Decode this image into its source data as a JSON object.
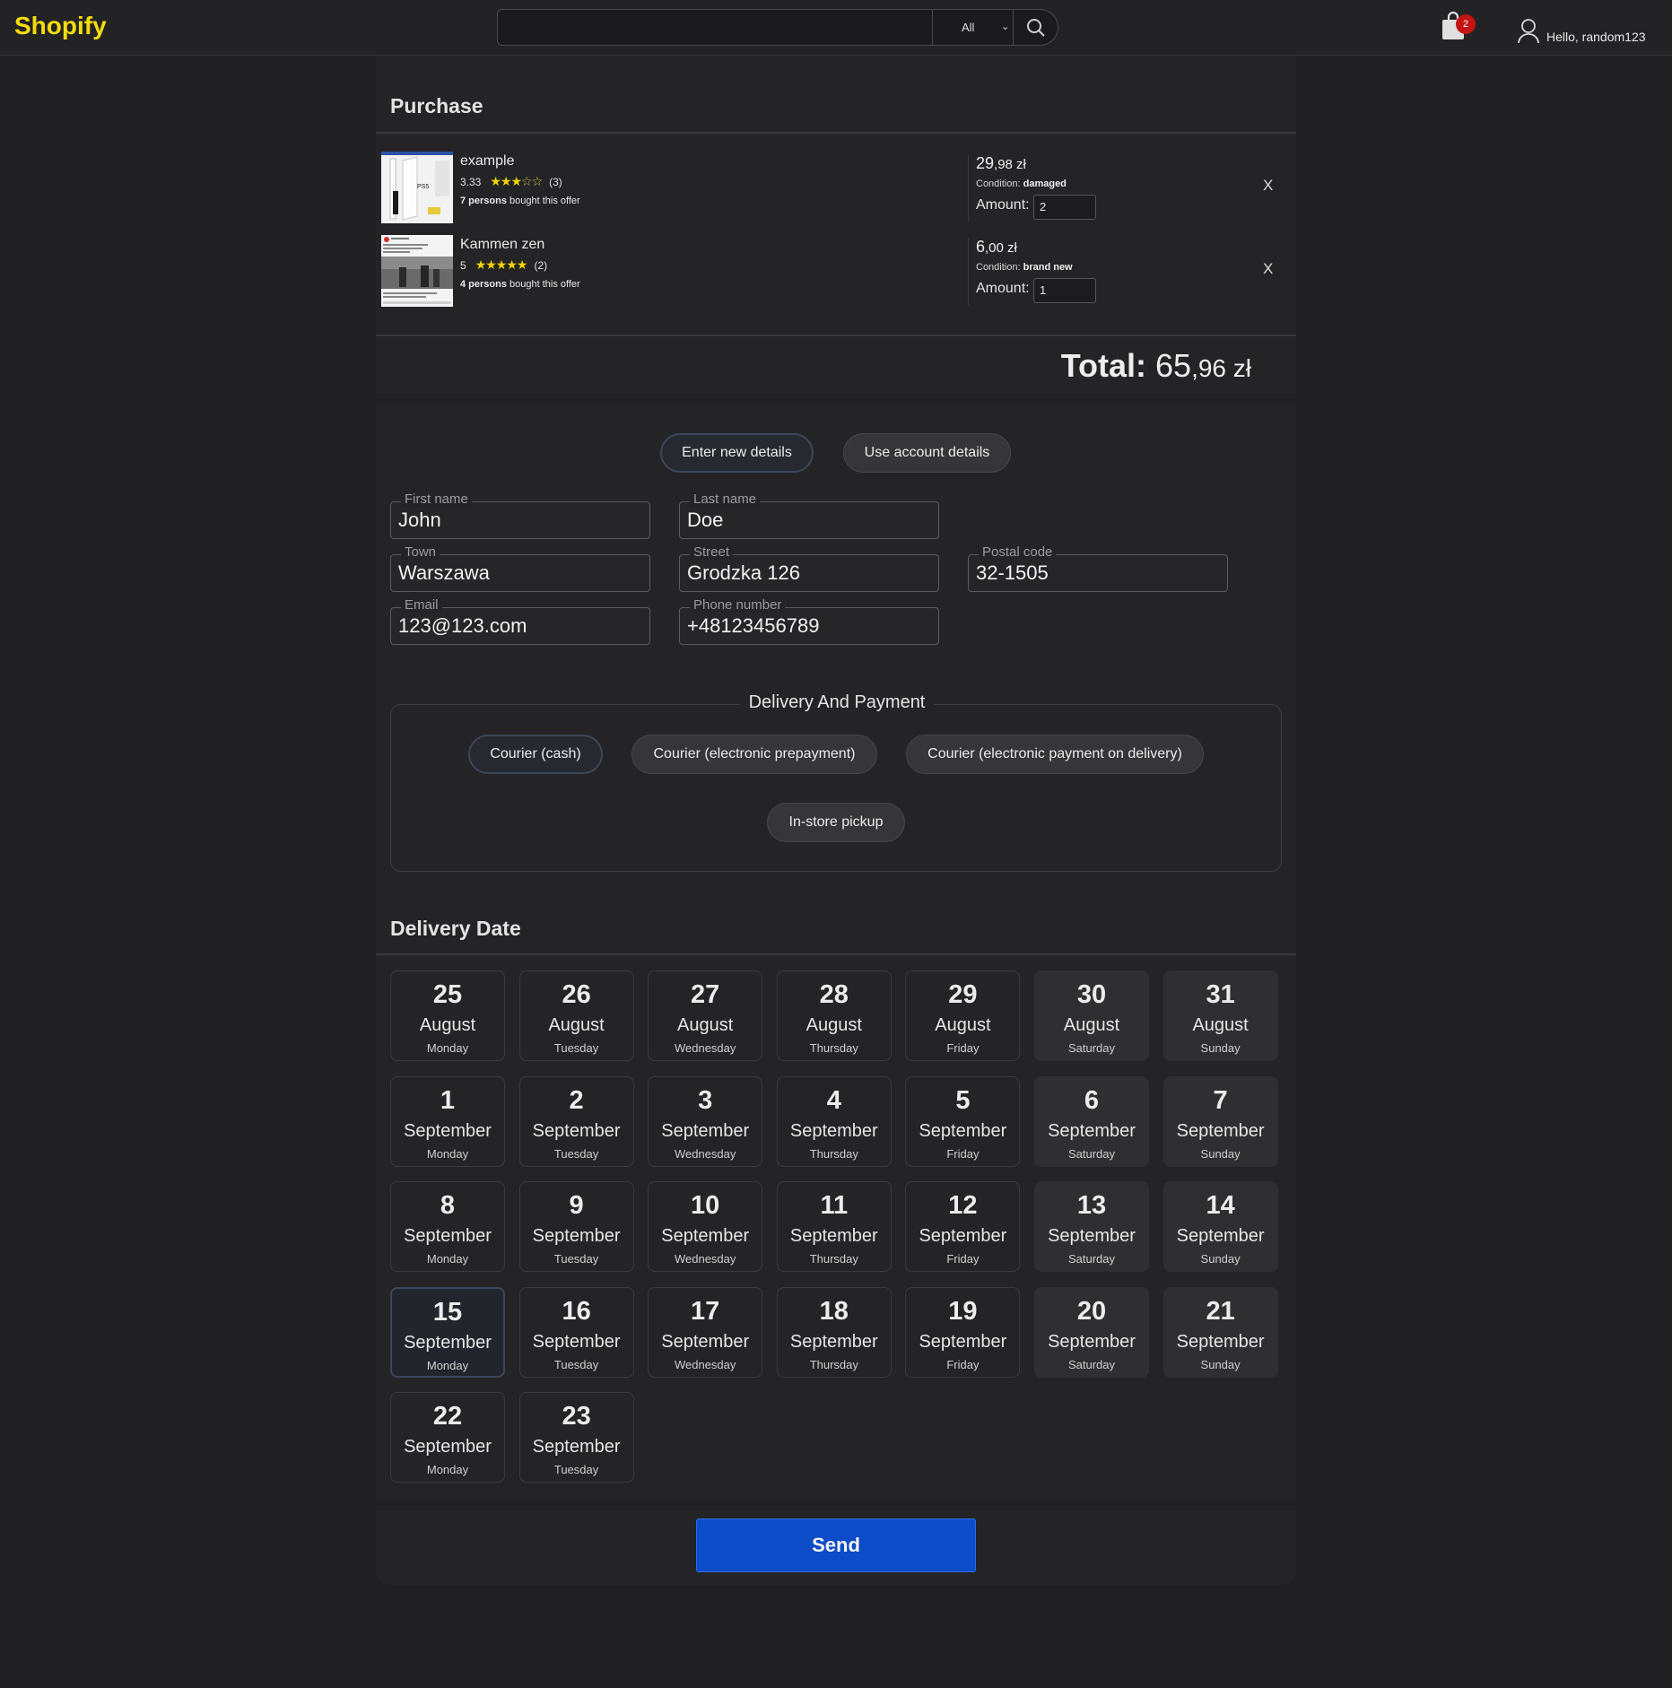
{
  "header": {
    "logo": "Shopify",
    "search_placeholder": "",
    "category": "All",
    "cart_count": "2",
    "user_greeting": "Hello, random123"
  },
  "purchase": {
    "title": "Purchase",
    "items": [
      {
        "name": "example",
        "rating": "3.33",
        "stars_filled": 3,
        "stars_total": 5,
        "reviews": "(3)",
        "bought_count": "7 persons",
        "bought_text": "bought this offer",
        "price_main": "29",
        "price_dec": ",98 zł",
        "condition_label": "Condition:",
        "condition": "damaged",
        "amount_label": "Amount:",
        "amount": "2",
        "remove": "X"
      },
      {
        "name": "Kammen zen",
        "rating": "5",
        "stars_filled": 5,
        "stars_total": 5,
        "reviews": "(2)",
        "bought_count": "4 persons",
        "bought_text": "bought this offer",
        "price_main": "6",
        "price_dec": ",00 zł",
        "condition_label": "Condition:",
        "condition": "brand new",
        "amount_label": "Amount:",
        "amount": "1",
        "remove": "X"
      }
    ],
    "total_label": "Total:",
    "total_main": "65",
    "total_dec": ",96 zł"
  },
  "details": {
    "enter_new": "Enter new details",
    "use_account": "Use account details",
    "fields": {
      "first_name": {
        "label": "First name",
        "value": "John"
      },
      "last_name": {
        "label": "Last name",
        "value": "Doe"
      },
      "town": {
        "label": "Town",
        "value": "Warszawa"
      },
      "street": {
        "label": "Street",
        "value": "Grodzka 126"
      },
      "postal": {
        "label": "Postal code",
        "value": "32-1505"
      },
      "email": {
        "label": "Email",
        "value": "123@123.com"
      },
      "phone": {
        "label": "Phone number",
        "value": "+48123456789"
      }
    }
  },
  "delivery_payment": {
    "title": "Delivery And Payment",
    "options": [
      "Courier (cash)",
      "Courier (electronic prepayment)",
      "Courier (electronic payment on delivery)",
      "In-store pickup"
    ],
    "selected": "Courier (cash)"
  },
  "delivery_date": {
    "title": "Delivery Date",
    "selected_index": 21,
    "days": [
      {
        "num": "25",
        "month": "August",
        "weekday": "Monday"
      },
      {
        "num": "26",
        "month": "August",
        "weekday": "Tuesday"
      },
      {
        "num": "27",
        "month": "August",
        "weekday": "Wednesday"
      },
      {
        "num": "28",
        "month": "August",
        "weekday": "Thursday"
      },
      {
        "num": "29",
        "month": "August",
        "weekday": "Friday"
      },
      {
        "num": "30",
        "month": "August",
        "weekday": "Saturday"
      },
      {
        "num": "31",
        "month": "August",
        "weekday": "Sunday"
      },
      {
        "num": "1",
        "month": "September",
        "weekday": "Monday"
      },
      {
        "num": "2",
        "month": "September",
        "weekday": "Tuesday"
      },
      {
        "num": "3",
        "month": "September",
        "weekday": "Wednesday"
      },
      {
        "num": "4",
        "month": "September",
        "weekday": "Thursday"
      },
      {
        "num": "5",
        "month": "September",
        "weekday": "Friday"
      },
      {
        "num": "6",
        "month": "September",
        "weekday": "Saturday"
      },
      {
        "num": "7",
        "month": "September",
        "weekday": "Sunday"
      },
      {
        "num": "8",
        "month": "September",
        "weekday": "Monday"
      },
      {
        "num": "9",
        "month": "September",
        "weekday": "Tuesday"
      },
      {
        "num": "10",
        "month": "September",
        "weekday": "Wednesday"
      },
      {
        "num": "11",
        "month": "September",
        "weekday": "Thursday"
      },
      {
        "num": "12",
        "month": "September",
        "weekday": "Friday"
      },
      {
        "num": "13",
        "month": "September",
        "weekday": "Saturday"
      },
      {
        "num": "14",
        "month": "September",
        "weekday": "Sunday"
      },
      {
        "num": "15",
        "month": "September",
        "weekday": "Monday"
      },
      {
        "num": "16",
        "month": "September",
        "weekday": "Tuesday"
      },
      {
        "num": "17",
        "month": "September",
        "weekday": "Wednesday"
      },
      {
        "num": "18",
        "month": "September",
        "weekday": "Thursday"
      },
      {
        "num": "19",
        "month": "September",
        "weekday": "Friday"
      },
      {
        "num": "20",
        "month": "September",
        "weekday": "Saturday"
      },
      {
        "num": "21",
        "month": "September",
        "weekday": "Sunday"
      },
      {
        "num": "22",
        "month": "September",
        "weekday": "Monday"
      },
      {
        "num": "23",
        "month": "September",
        "weekday": "Tuesday"
      }
    ]
  },
  "send_label": "Send",
  "colors": {
    "brand": "#f4dc0a",
    "accent": "#0d4cc8",
    "badge": "#c41414",
    "star": "#f2d500"
  }
}
